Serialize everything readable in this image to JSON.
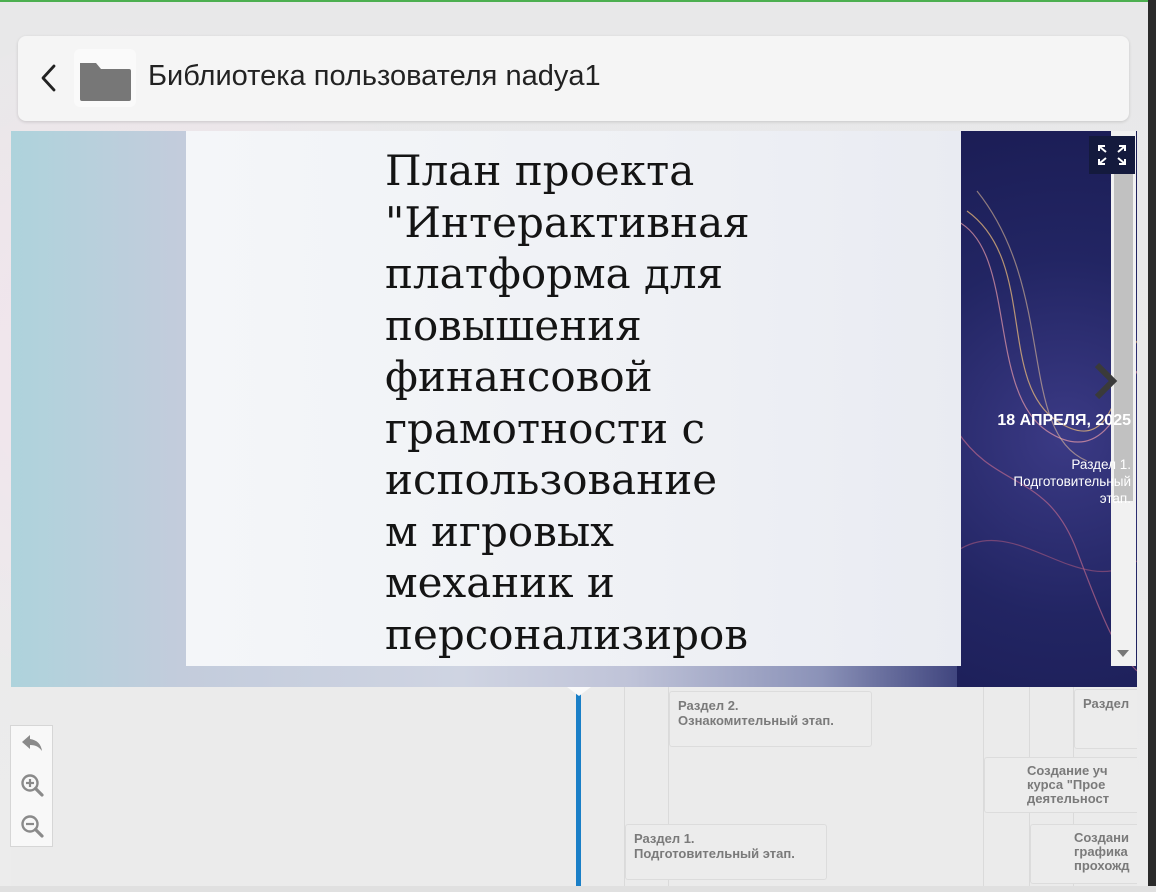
{
  "header": {
    "title": "Библиотека пользователя nadya1",
    "back_icon": "chevron-left-icon",
    "folder_icon": "folder-icon"
  },
  "slide": {
    "title": "План проекта \"Интерактивная платформа для повышения финансовой грамотности с использование м игровых механик и персонализиров"
  },
  "current_event": {
    "date": "18 АПРЕЛЯ, 2025",
    "description": "Раздел 1. Подготовительный этап."
  },
  "timeline_cards": [
    {
      "id": "s2",
      "text": [
        "Раздел 2.",
        "Ознакомительный этап."
      ]
    },
    {
      "id": "s1",
      "text": [
        "Раздел 1.",
        "Подготовительный этап."
      ]
    },
    {
      "id": "s3",
      "text": [
        "Раздел"
      ]
    },
    {
      "id": "c1",
      "text": [
        "Создание уч",
        "курса \"Прое",
        "деятельност"
      ]
    },
    {
      "id": "c2",
      "text": [
        "Создани",
        "графика",
        "прохожд"
      ]
    }
  ],
  "controls": {
    "fullscreen_icon": "fullscreen-icon",
    "next_icon": "chevron-right-icon",
    "back_icon": "undo-arrow-icon",
    "zoom_in_icon": "zoom-in-icon",
    "zoom_out_icon": "zoom-out-icon"
  },
  "colors": {
    "marker": "#1a7fc7",
    "banner_dark": "#1e2256",
    "banner_light": "#aed3dc"
  }
}
